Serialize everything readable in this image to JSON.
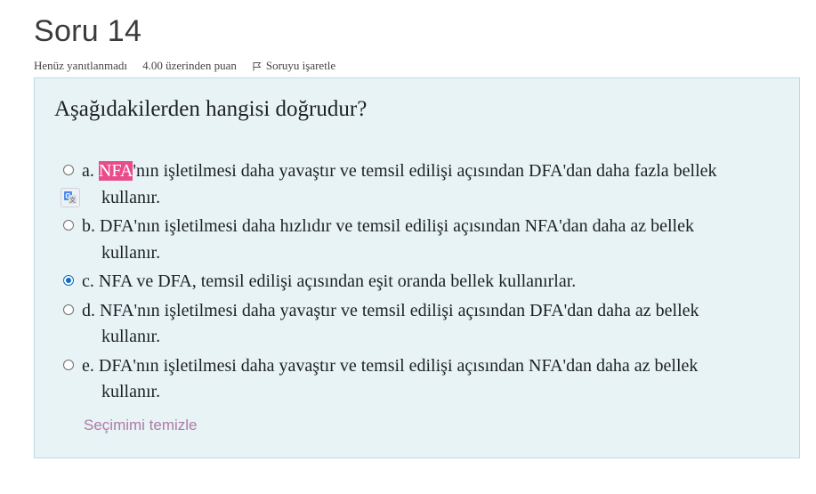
{
  "question": {
    "title": "Soru 14",
    "status": "Henüz yanıtlanmadı",
    "grade": "4.00 üzerinden puan",
    "flag_label": "Soruyu işaretle",
    "text": "Aşağıdakilerden hangisi doğrudur?"
  },
  "answers": [
    {
      "letter": "a.",
      "highlight": "NFA",
      "line1": "'nın işletilmesi daha yavaştır ve temsil edilişi açısından DFA'dan daha fazla bellek",
      "line2": "kullanır.",
      "selected": false
    },
    {
      "letter": "b.",
      "line1": "DFA'nın işletilmesi daha hızlıdır ve temsil edilişi açısından NFA'dan daha az bellek",
      "line2": "kullanır.",
      "selected": false
    },
    {
      "letter": "c.",
      "line1": "NFA ve DFA, temsil edilişi açısından eşit oranda bellek kullanırlar.",
      "selected": true
    },
    {
      "letter": "d.",
      "line1": "NFA'nın işletilmesi daha yavaştır ve temsil edilişi açısından DFA'dan daha az bellek",
      "line2": "kullanır.",
      "selected": false
    },
    {
      "letter": "e.",
      "line1": "DFA'nın işletilmesi daha yavaştır ve temsil edilişi açısından NFA'dan daha az bellek",
      "line2": "kullanır.",
      "selected": false
    }
  ],
  "clear_label": "Seçimimi temizle",
  "icons": {
    "flag": "flag-icon",
    "translate": "google-translate-icon"
  },
  "colors": {
    "accent": "#0f6cbf",
    "highlight": "#e94c8c",
    "panel": "#e7f3f5",
    "clear_link": "#b07aa5"
  }
}
